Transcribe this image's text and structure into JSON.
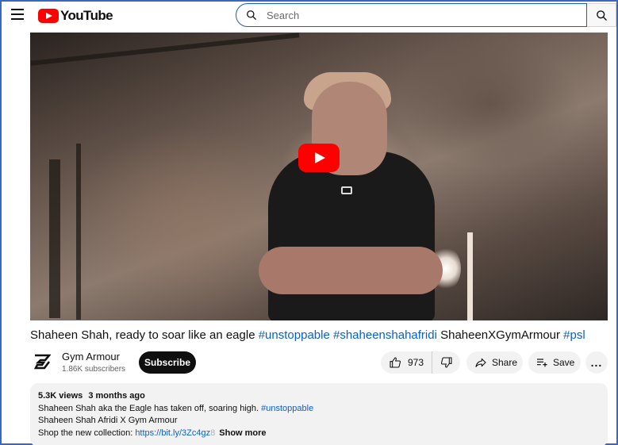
{
  "header": {
    "logo_text": "YouTube",
    "search_placeholder": "Search"
  },
  "video": {
    "title_parts": {
      "text": "Shaheen Shah, ready to soar like an eagle",
      "tag1": "#unstoppable",
      "tag2": "#shaheenshahafridi",
      "text2": "ShaheenXGymArmour",
      "tag3": "#psl"
    }
  },
  "channel": {
    "name": "Gym Armour",
    "subscribers": "1.86K subscribers",
    "subscribe_label": "Subscribe"
  },
  "actions": {
    "likes": "973",
    "share_label": "Share",
    "save_label": "Save",
    "more_label": "..."
  },
  "description": {
    "views": "5.3K views",
    "age": "3 months ago",
    "line1": "Shaheen Shah aka the Eagle has taken off, soaring high.",
    "line1_tag": "#unstoppable",
    "line2": "Shaheen Shah Afridi X Gym Armour",
    "line3": "Shop the new collection:",
    "link": "https://bit.ly/3Zc4gz",
    "link_fade": "8",
    "show_more": "Show more"
  },
  "colors": {
    "accent_red": "#ff0000",
    "link_blue": "#065fd4",
    "frame_border": "#3a66c4"
  }
}
